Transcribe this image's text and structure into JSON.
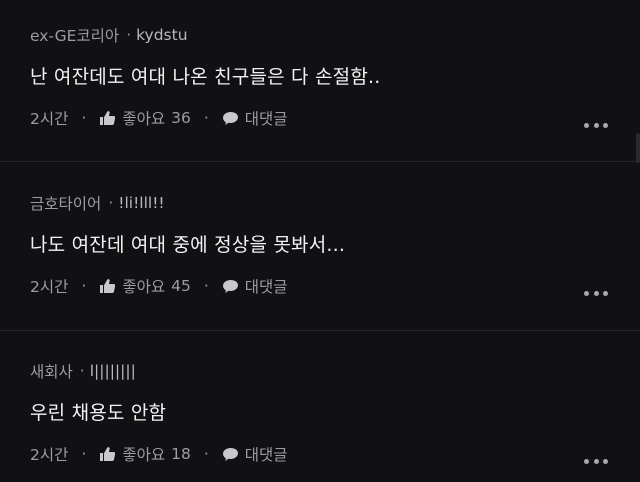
{
  "comments": [
    {
      "company": "ex-GE코리아",
      "separator": "·",
      "username": "kydstu",
      "text": "난 여잔데도 여대 나온 친구들은 다 손절함..",
      "time": "2시간",
      "like_label": "좋아요",
      "like_count": "36",
      "reply_label": "대댓글"
    },
    {
      "company": "금호타이어",
      "separator": "·",
      "username": "!li!lll!!",
      "text": "나도 여잔데 여대 중에 정상을 못봐서...",
      "time": "2시간",
      "like_label": "좋아요",
      "like_count": "45",
      "reply_label": "대댓글"
    },
    {
      "company": "새회사",
      "separator": "·",
      "username": "l||||||||",
      "text": "우린 채용도 안함",
      "time": "2시간",
      "like_label": "좋아요",
      "like_count": "18",
      "reply_label": "대댓글"
    }
  ],
  "action_separator": "·",
  "icons": {
    "like": "thumbs-up-icon",
    "reply": "speech-bubble-icon",
    "more": "more-horizontal-icon"
  },
  "colors": {
    "background": "#111113",
    "text_primary": "#f2f2f4",
    "text_secondary": "#9c9ca1",
    "divider": "#262629"
  }
}
